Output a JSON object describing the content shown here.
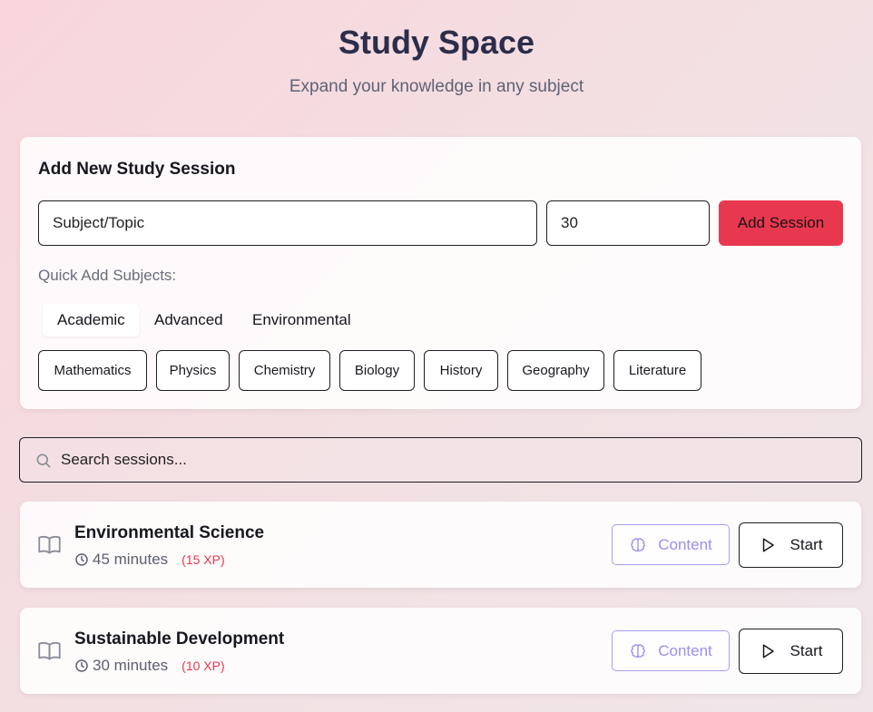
{
  "header": {
    "title": "Study Space",
    "subtitle": "Expand your knowledge in any subject"
  },
  "add_session": {
    "heading": "Add New Study Session",
    "subject_placeholder": "Subject/Topic",
    "minutes_value": "30",
    "add_button": "Add Session",
    "quick_add_label": "Quick Add Subjects:",
    "categories": [
      {
        "label": "Academic",
        "active": true
      },
      {
        "label": "Advanced",
        "active": false
      },
      {
        "label": "Environmental",
        "active": false
      }
    ],
    "subjects": [
      "Mathematics",
      "Physics",
      "Chemistry",
      "Biology",
      "History",
      "Geography",
      "Literature"
    ]
  },
  "search": {
    "placeholder": "Search sessions..."
  },
  "sessions": [
    {
      "name": "Environmental Science",
      "duration": "45 minutes",
      "xp": "(15 XP)",
      "content_label": "Content",
      "start_label": "Start"
    },
    {
      "name": "Sustainable Development",
      "duration": "30 minutes",
      "xp": "(10 XP)",
      "content_label": "Content",
      "start_label": "Start"
    }
  ],
  "colors": {
    "accent": "#e8384f",
    "content_purple": "#9a8ff0",
    "title": "#2b2d4a"
  },
  "icons": {
    "search": "search-icon",
    "book": "book-open-icon",
    "clock": "clock-icon",
    "brain": "brain-icon",
    "play": "play-icon"
  }
}
